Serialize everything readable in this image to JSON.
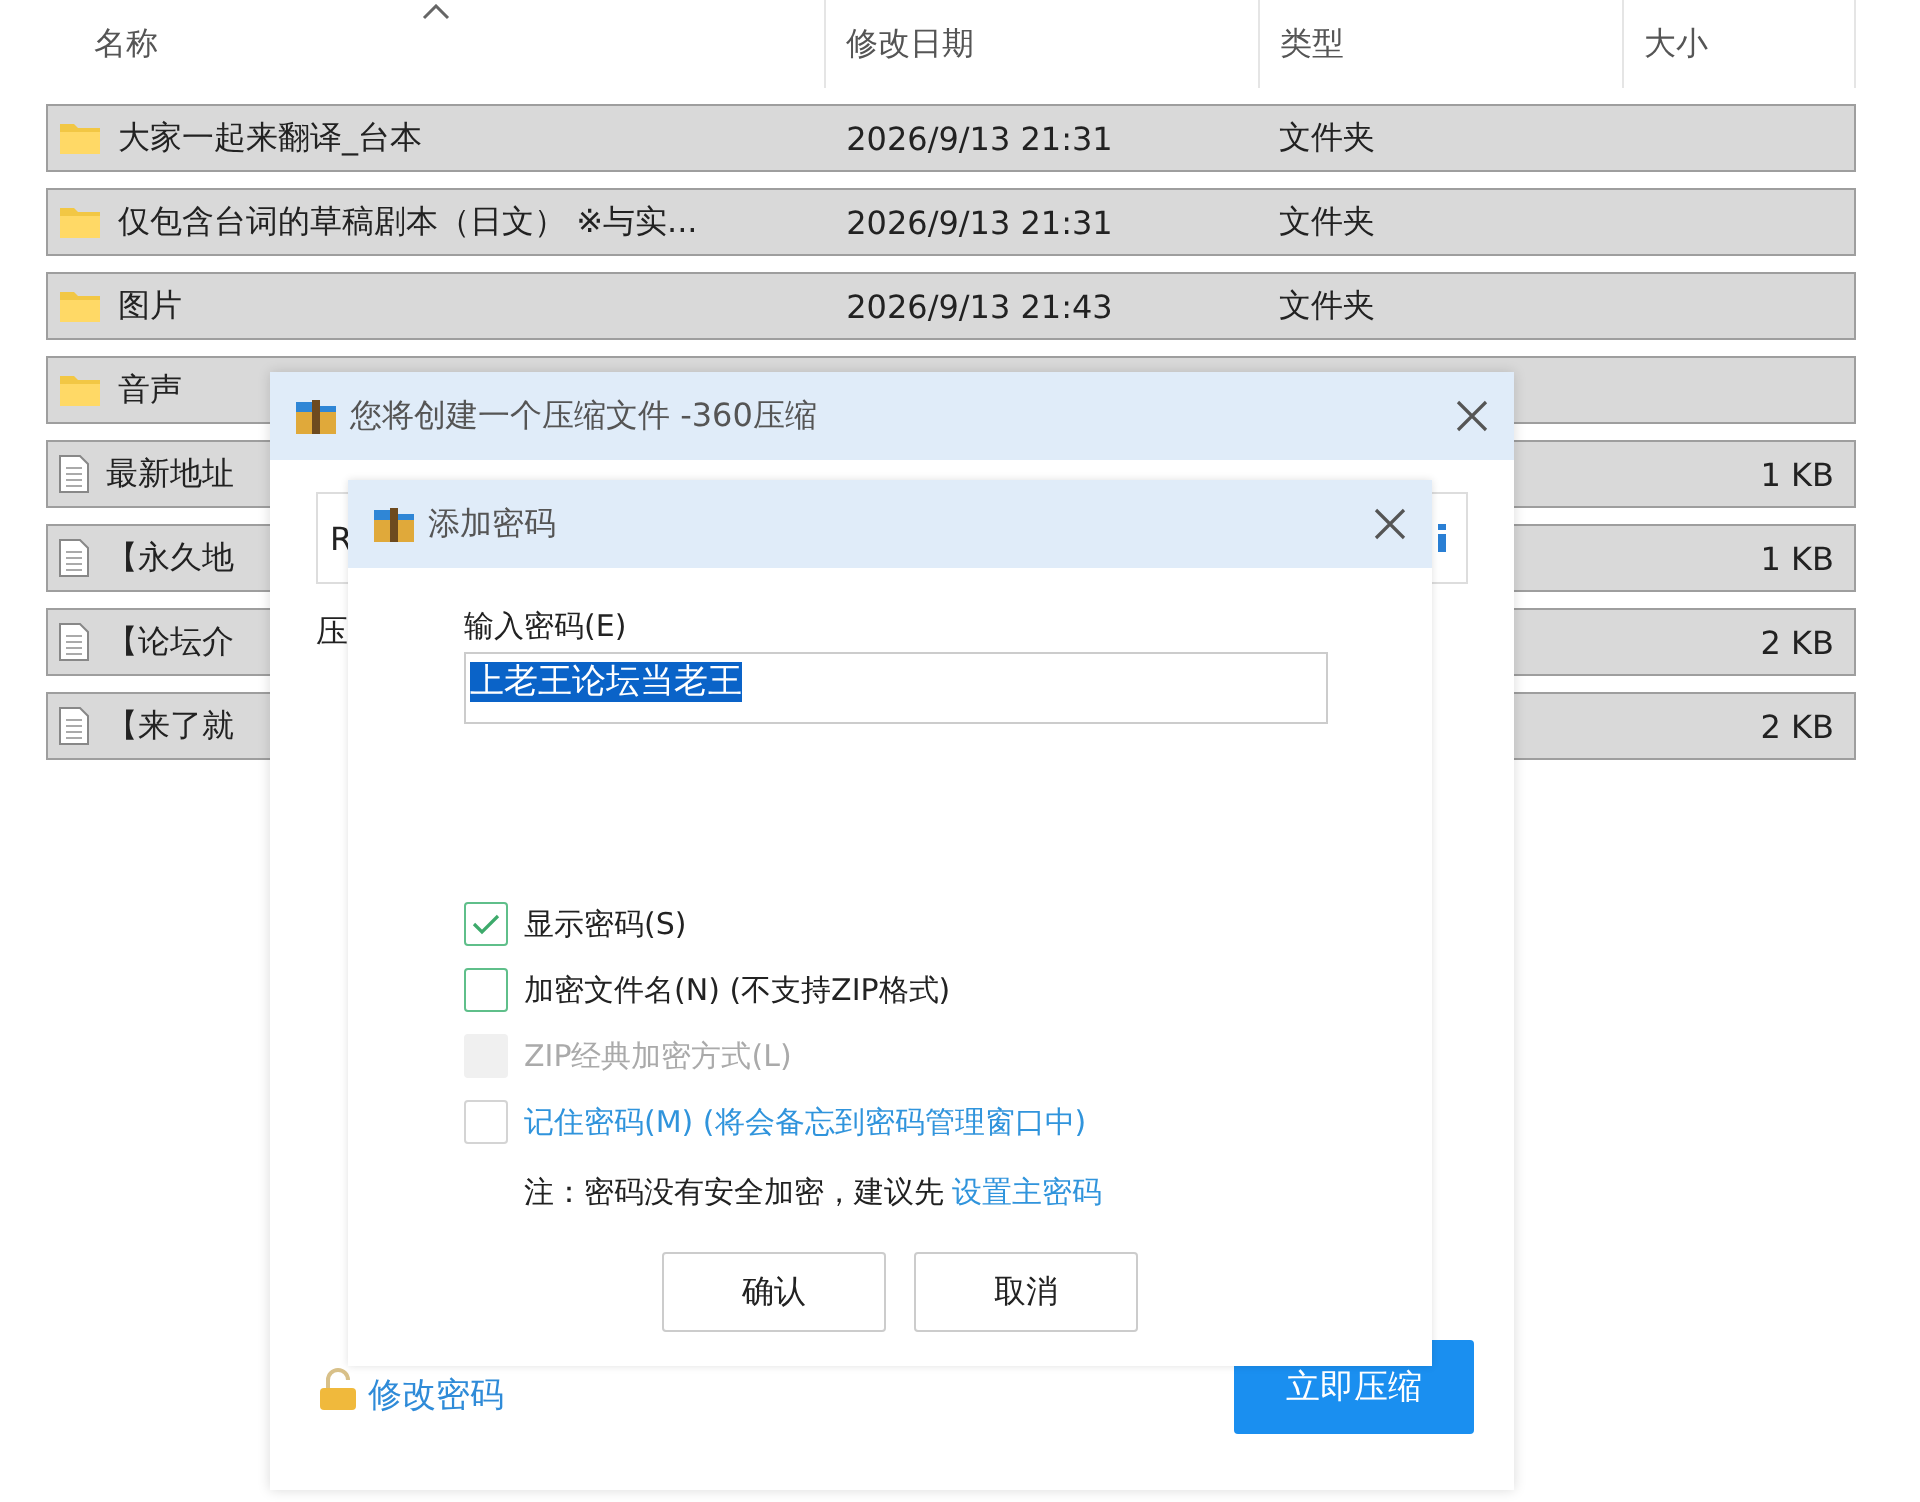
{
  "explorer": {
    "columns": [
      {
        "label": "名称",
        "sorted": true
      },
      {
        "label": "修改日期",
        "sorted": false
      },
      {
        "label": "类型",
        "sorted": false
      },
      {
        "label": "大小",
        "sorted": false
      }
    ],
    "rows": [
      {
        "kind": "folder",
        "name": "大家一起来翻译_台本",
        "date": "2026/9/13 21:31",
        "type": "文件夹"
      },
      {
        "kind": "folder",
        "name": "仅包含台词的草稿剧本（日文） ※与实...",
        "date": "2026/9/13 21:31",
        "type": "文件夹"
      },
      {
        "kind": "folder",
        "name": "图片",
        "date": "2026/9/13 21:43",
        "type": "文件夹"
      },
      {
        "kind": "folder",
        "name": "音声"
      },
      {
        "kind": "file",
        "name": "最新地址",
        "size": "1 KB"
      },
      {
        "kind": "file",
        "name": "【永久地",
        "size": "1 KB"
      },
      {
        "kind": "file",
        "name": "【论坛介",
        "size": "2 KB"
      },
      {
        "kind": "file",
        "name": "【来了就",
        "size": "2 KB"
      }
    ]
  },
  "compress_dialog": {
    "title": "您将创建一个压缩文件 -360压缩",
    "path_field": {
      "value": "R"
    },
    "label": "压",
    "change_password_link": "修改密码",
    "compress_button": "立即压缩"
  },
  "password_dialog": {
    "title": "添加密码",
    "password_label": "输入密码(E)",
    "password": {
      "value": "上老王论坛当老王",
      "selected": true
    },
    "options": [
      {
        "kind": "option",
        "label": "显示密码(S)",
        "checked": true,
        "disabled": false
      },
      {
        "kind": "option",
        "label": "加密文件名(N) (不支持ZIP格式)",
        "checked": false,
        "disabled": false
      },
      {
        "kind": "option",
        "label": "ZIP经典加密方式(L)",
        "checked": false,
        "disabled": true
      },
      {
        "kind": "link",
        "label": "记住密码(M) (将会备忘到密码管理窗口中)",
        "checked": false,
        "disabled": false
      }
    ],
    "note": "注：密码没有安全加密，建议先",
    "note_link": "设置主密码",
    "buttons": [
      "确认",
      "取消"
    ]
  }
}
